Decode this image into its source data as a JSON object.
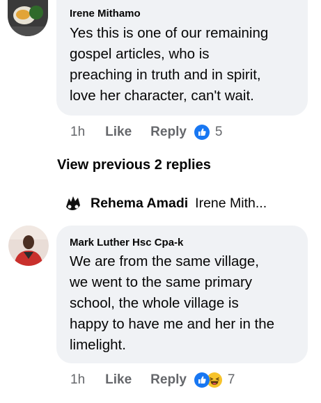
{
  "comments": [
    {
      "author": "Irene Mithamo",
      "text_lines": [
        "Yes this is one of our remaining",
        "gospel articles, who is",
        "preaching in truth and in spirit,",
        "love her character, can't wait."
      ],
      "time": "1h",
      "like_label": "Like",
      "reply_label": "Reply",
      "reaction_count": "5"
    },
    {
      "author": "Mark Luther Hsc Cpa-k",
      "text_lines": [
        "We are from the same village,",
        "we went to the same primary",
        "school, the whole village is",
        "happy to have me and her in the",
        "limelight."
      ],
      "time": "1h",
      "like_label": "Like",
      "reply_label": "Reply",
      "reaction_count": "7"
    }
  ],
  "view_previous_label": "View previous 2 replies",
  "reply_preview": {
    "author": "Rehema Amadi",
    "text": "Irene Mith..."
  },
  "colors": {
    "bubble": "#f0f2f5",
    "meta_text": "#65676b",
    "like_blue": "#1877f2",
    "haha_yellow": "#f7c32b"
  },
  "icons": {
    "like_reaction": "thumbs-up-icon",
    "haha_reaction": "laughing-face-icon"
  }
}
